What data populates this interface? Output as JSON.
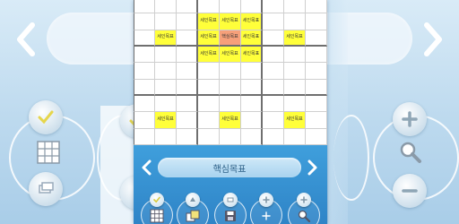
{
  "grid": {
    "goal_label": "세인목표",
    "core_label": "핵심목표",
    "cells": [
      [
        "",
        "",
        "",
        "",
        "",
        "",
        "",
        "",
        ""
      ],
      [
        "",
        "",
        "",
        "세인목표",
        "세인목표",
        "세인목표",
        "",
        "",
        ""
      ],
      [
        "",
        "세인목표",
        "",
        "세인목표",
        "핵심목표",
        "세인목표",
        "",
        "세인목표",
        ""
      ],
      [
        "",
        "",
        "",
        "세인목표",
        "세인목표",
        "세인목표",
        "",
        "",
        ""
      ],
      [
        "",
        "",
        "",
        "",
        "",
        "",
        "",
        "",
        ""
      ],
      [
        "",
        "",
        "",
        "",
        "",
        "",
        "",
        "",
        ""
      ],
      [
        "",
        "",
        "",
        "",
        "",
        "",
        "",
        "",
        ""
      ],
      [
        "",
        "세인목표",
        "",
        "",
        "세인목표",
        "",
        "",
        "세인목표",
        ""
      ],
      [
        "",
        "",
        "",
        "",
        "",
        "",
        "",
        "",
        ""
      ]
    ],
    "cell_types": [
      [
        "",
        "",
        "",
        "",
        "",
        "",
        "",
        "",
        ""
      ],
      [
        "",
        "",
        "",
        "goal",
        "goal",
        "goal",
        "",
        "",
        ""
      ],
      [
        "",
        "goal",
        "",
        "goal",
        "core",
        "goal",
        "",
        "goal",
        ""
      ],
      [
        "",
        "",
        "",
        "goal",
        "goal",
        "goal",
        "",
        "",
        ""
      ],
      [
        "",
        "",
        "",
        "",
        "",
        "",
        "",
        "",
        ""
      ],
      [
        "",
        "",
        "",
        "",
        "",
        "",
        "",
        "",
        ""
      ],
      [
        "",
        "",
        "",
        "",
        "",
        "",
        "",
        "",
        ""
      ],
      [
        "",
        "goal",
        "",
        "",
        "goal",
        "",
        "",
        "goal",
        ""
      ],
      [
        "",
        "",
        "",
        "",
        "",
        "",
        "",
        "",
        ""
      ]
    ]
  },
  "bottom": {
    "title": "핵심목표",
    "prev_icon": "chevron-left-icon",
    "next_icon": "chevron-right-icon"
  },
  "toolbar": {
    "tools": [
      {
        "name": "check-grid",
        "bubble": "check-icon",
        "icon": "grid-icon"
      },
      {
        "name": "layers",
        "bubble": "arrow-up-icon",
        "icon": "layers-icon"
      },
      {
        "name": "save",
        "bubble": "stack-icon",
        "icon": "disk-icon"
      },
      {
        "name": "zoom-in",
        "bubble": "plus-icon",
        "icon": "zoom-in-icon"
      },
      {
        "name": "zoom",
        "bubble": "plus-icon",
        "icon": "magnifier-icon"
      }
    ]
  },
  "colors": {
    "goal_cell": "#ffff3a",
    "core_cell": "#f6a07a",
    "sheet_blue": "#3f9fdc",
    "title_text": "#2c5f86"
  }
}
